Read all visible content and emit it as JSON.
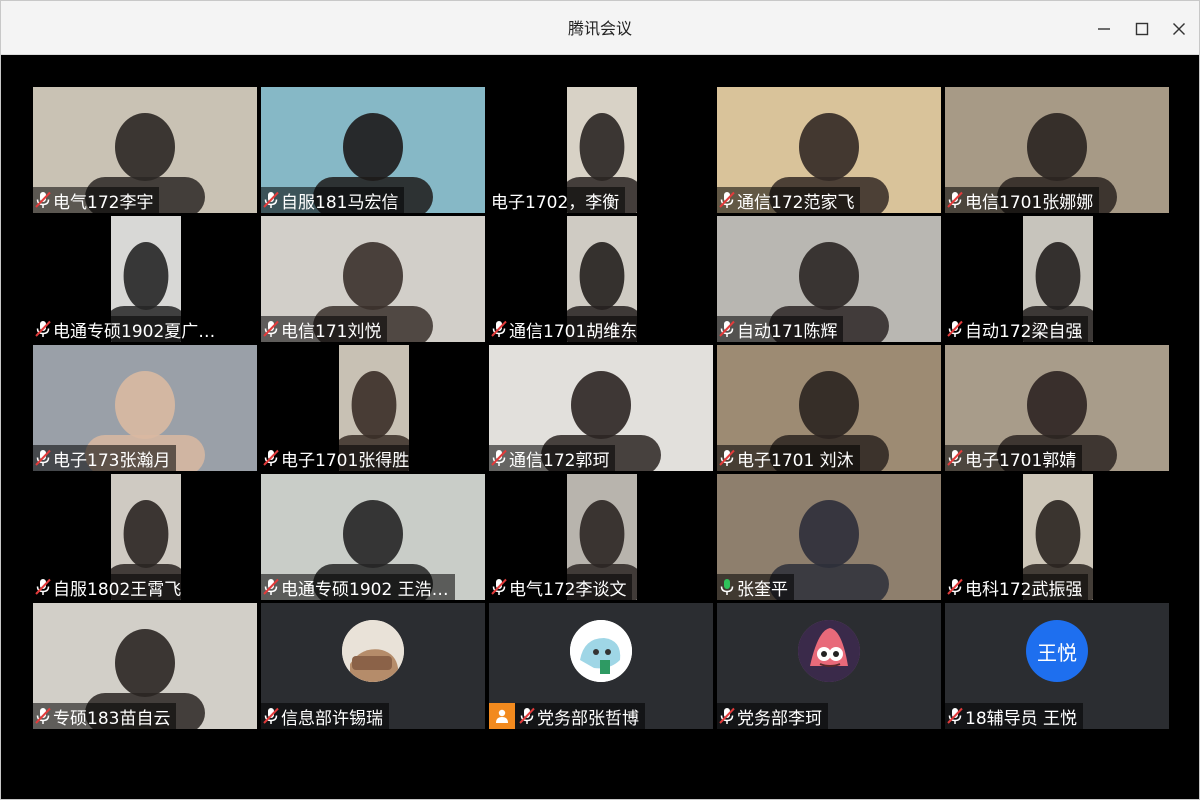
{
  "window": {
    "title": "腾讯会议"
  },
  "participants": [
    {
      "name": "电气172李宇",
      "mic": "muted",
      "feed": {
        "bg": "#c9c2b4",
        "person": "#2b2724"
      }
    },
    {
      "name": "自服181马宏信",
      "mic": "muted",
      "feed": {
        "bg": "#86b8c6",
        "person": "#1d1a19"
      }
    },
    {
      "name": "电子1702，李衡",
      "mic": "none",
      "feed": {
        "bg": "#d8d2c6",
        "person": "#2a2522"
      }
    },
    {
      "name": "通信172范家飞",
      "mic": "muted",
      "feed": {
        "bg": "#d9c39a",
        "person": "#322925"
      }
    },
    {
      "name": "电信1701张娜娜",
      "mic": "muted",
      "feed": {
        "bg": "#a79a86",
        "person": "#2a2320"
      }
    },
    {
      "name": "电通专硕1902夏广…",
      "mic": "muted",
      "feed": {
        "bg": "#d8d8d6",
        "person": "#262626"
      }
    },
    {
      "name": "电信171刘悦",
      "mic": "muted",
      "feed": {
        "bg": "#d2cfc9",
        "person": "#3a302b"
      }
    },
    {
      "name": "通信1701胡维东",
      "mic": "muted",
      "feed": {
        "bg": "#cfcbc3",
        "person": "#24201e"
      }
    },
    {
      "name": "自动171陈辉",
      "mic": "muted",
      "feed": {
        "bg": "#b9b7b2",
        "person": "#2b2624"
      }
    },
    {
      "name": "自动172梁自强",
      "mic": "muted",
      "feed": {
        "bg": "#c7c4bc",
        "person": "#23201e"
      }
    },
    {
      "name": "电子173张瀚月",
      "mic": "muted",
      "feed": {
        "bg": "#9aa0a8",
        "person": "#d9b9a1"
      }
    },
    {
      "name": "电子1701张得胜",
      "mic": "muted",
      "feed": {
        "bg": "#c8c1b4",
        "person": "#3a2e27"
      }
    },
    {
      "name": "通信172郭珂",
      "mic": "muted",
      "feed": {
        "bg": "#e2e0dc",
        "person": "#2c2522"
      }
    },
    {
      "name": "电子1701 刘沐",
      "mic": "muted",
      "feed": {
        "bg": "#9d8b73",
        "person": "#2b2320"
      }
    },
    {
      "name": "电子1701郭婧",
      "mic": "muted",
      "feed": {
        "bg": "#a89c8a",
        "person": "#2c2421"
      }
    },
    {
      "name": "自服1802王霄飞",
      "mic": "muted",
      "feed": {
        "bg": "#cfcac2",
        "person": "#2a2522"
      }
    },
    {
      "name": "电通专硕1902 王浩…",
      "mic": "muted",
      "feed": {
        "bg": "#c9cdc8",
        "person": "#252525"
      }
    },
    {
      "name": "电气172李谈文",
      "mic": "muted",
      "feed": {
        "bg": "#b8b4ad",
        "person": "#2c2623"
      }
    },
    {
      "name": "张奎平",
      "mic": "active",
      "feed": {
        "bg": "#8e7f6d",
        "person": "#2d2f3a"
      }
    },
    {
      "name": "电科172武振强",
      "mic": "muted",
      "feed": {
        "bg": "#cdc6b8",
        "person": "#2a2420"
      }
    },
    {
      "name": "专硕183苗自云",
      "mic": "muted",
      "feed": {
        "bg": "#d2cfc8",
        "person": "#2a2522"
      }
    },
    {
      "name": "信息部许锡瑞",
      "mic": "muted",
      "avatar": {
        "type": "photo",
        "bg": "#d8cfc4"
      }
    },
    {
      "name": "党务部张哲博",
      "mic": "muted",
      "host": true,
      "avatar": {
        "type": "cartoon",
        "bg": "#ffffff"
      }
    },
    {
      "name": "党务部李珂",
      "mic": "muted",
      "avatar": {
        "type": "cartoon",
        "bg": "#8a5a8a"
      }
    },
    {
      "name": "18辅导员 王悦",
      "mic": "muted",
      "avatar": {
        "type": "initials",
        "bg": "#1e6fef",
        "text": "王悦"
      }
    }
  ]
}
